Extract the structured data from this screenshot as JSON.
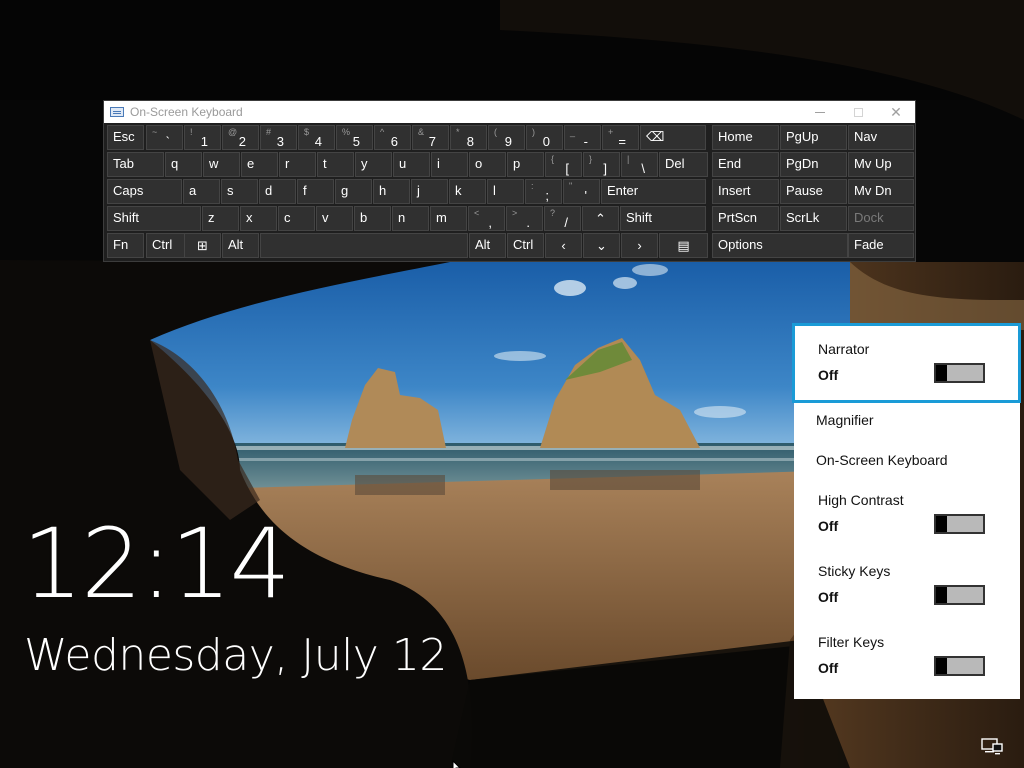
{
  "lockscreen": {
    "time": "12:14",
    "date": "Wednesday, July 12"
  },
  "osk": {
    "title": "On-Screen Keyboard",
    "window_buttons": {
      "minimize": "—",
      "maximize": "☐",
      "close": "✕"
    },
    "rows": [
      {
        "keys": [
          {
            "label": "Esc"
          },
          {
            "shift": "~",
            "main": "`"
          },
          {
            "shift": "!",
            "main": "1"
          },
          {
            "shift": "@",
            "main": "2"
          },
          {
            "shift": "#",
            "main": "3"
          },
          {
            "shift": "$",
            "main": "4"
          },
          {
            "shift": "%",
            "main": "5"
          },
          {
            "shift": "^",
            "main": "6"
          },
          {
            "shift": "&",
            "main": "7"
          },
          {
            "shift": "*",
            "main": "8"
          },
          {
            "shift": "(",
            "main": "9"
          },
          {
            "shift": ")",
            "main": "0"
          },
          {
            "shift": "_",
            "main": "-"
          },
          {
            "shift": "+",
            "main": "="
          },
          {
            "label": "⌫"
          },
          {
            "label": "Home"
          },
          {
            "label": "PgUp"
          },
          {
            "label": "Nav"
          }
        ]
      },
      {
        "keys": [
          {
            "label": "Tab"
          },
          {
            "label": "q"
          },
          {
            "label": "w"
          },
          {
            "label": "e"
          },
          {
            "label": "r"
          },
          {
            "label": "t"
          },
          {
            "label": "y"
          },
          {
            "label": "u"
          },
          {
            "label": "i"
          },
          {
            "label": "o"
          },
          {
            "label": "p"
          },
          {
            "shift": "{",
            "main": "["
          },
          {
            "shift": "}",
            "main": "]"
          },
          {
            "shift": "|",
            "main": "\\"
          },
          {
            "label": "Del"
          },
          {
            "label": "End"
          },
          {
            "label": "PgDn"
          },
          {
            "label": "Mv Up"
          }
        ]
      },
      {
        "keys": [
          {
            "label": "Caps"
          },
          {
            "label": "a"
          },
          {
            "label": "s"
          },
          {
            "label": "d"
          },
          {
            "label": "f"
          },
          {
            "label": "g"
          },
          {
            "label": "h"
          },
          {
            "label": "j"
          },
          {
            "label": "k"
          },
          {
            "label": "l"
          },
          {
            "shift": ":",
            "main": ";"
          },
          {
            "shift": "\"",
            "main": "'"
          },
          {
            "label": "Enter"
          },
          {
            "label": "Insert"
          },
          {
            "label": "Pause"
          },
          {
            "label": "Mv Dn"
          }
        ]
      },
      {
        "keys": [
          {
            "label": "Shift"
          },
          {
            "label": "z"
          },
          {
            "label": "x"
          },
          {
            "label": "c"
          },
          {
            "label": "v"
          },
          {
            "label": "b"
          },
          {
            "label": "n"
          },
          {
            "label": "m"
          },
          {
            "shift": "<",
            "main": ","
          },
          {
            "shift": ">",
            "main": "."
          },
          {
            "shift": "?",
            "main": "/"
          },
          {
            "label": "⌃"
          },
          {
            "label": "Shift"
          },
          {
            "label": "PrtScn"
          },
          {
            "label": "ScrLk"
          },
          {
            "label": "Dock"
          }
        ]
      },
      {
        "keys": [
          {
            "label": "Fn"
          },
          {
            "label": "Ctrl"
          },
          {
            "label": "⊞"
          },
          {
            "label": "Alt"
          },
          {
            "label": ""
          },
          {
            "label": "Alt"
          },
          {
            "label": "Ctrl"
          },
          {
            "label": "‹"
          },
          {
            "label": "⌄"
          },
          {
            "label": "›"
          },
          {
            "label": "▤"
          },
          {
            "label": "Options"
          },
          {
            "label": "Fade"
          }
        ]
      }
    ]
  },
  "ease_of_access": {
    "items": [
      {
        "name": "Narrator",
        "state": "Off",
        "toggle": "off"
      },
      {
        "name": "Magnifier"
      },
      {
        "name": "On-Screen Keyboard"
      },
      {
        "name": "High Contrast",
        "state": "Off",
        "toggle": "off"
      },
      {
        "name": "Sticky Keys",
        "state": "Off",
        "toggle": "off"
      },
      {
        "name": "Filter Keys",
        "state": "Off",
        "toggle": "off"
      }
    ]
  },
  "icons": {
    "network": "network-icon",
    "keyboard": "keyboard-icon"
  },
  "colors": {
    "focus_border": "#1a9bd7",
    "key_bg": "#303030",
    "panel_bg": "#ffffff"
  }
}
